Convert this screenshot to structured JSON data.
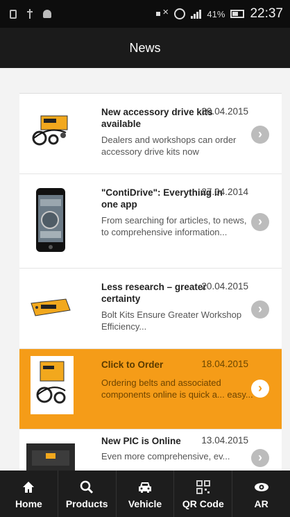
{
  "status_bar": {
    "battery_percent": "41%",
    "time": "22:37",
    "icons": [
      "screenshot-icon",
      "usb-icon",
      "android-icon",
      "mute-icon",
      "alarm-icon",
      "signal-icon",
      "battery-icon"
    ]
  },
  "header": {
    "title": "News"
  },
  "news": [
    {
      "title": "New accessory drive kits available",
      "date": "30.04.2015",
      "desc": "Dealers and workshops can order accessory drive kits now",
      "thumb": "belt-kit-image"
    },
    {
      "title": "\"ContiDrive\": Everything in one app",
      "date": "27.04.2014",
      "desc": "From searching for articles, to news, to comprehensive information...",
      "thumb": "phone-app-image"
    },
    {
      "title": "Less research – greater certainty",
      "date": "20.04.2015",
      "desc": "Bolt Kits Ensure Greater Workshop Efficiency...",
      "thumb": "bolt-kit-image"
    },
    {
      "title": "Click to Order",
      "date": "18.04.2015",
      "desc": "Ordering belts and associated components online is quick a... easy...",
      "thumb": "order-kit-image",
      "selected": true
    },
    {
      "title": "New PIC is Online",
      "date": "13.04.2015",
      "desc": "Even more comprehensive, ev...",
      "thumb": "pic-online-image"
    }
  ],
  "tabs": [
    {
      "label": "Home",
      "icon": "home-icon"
    },
    {
      "label": "Products",
      "icon": "search-icon"
    },
    {
      "label": "Vehicle",
      "icon": "car-icon"
    },
    {
      "label": "QR Code",
      "icon": "qr-code-icon"
    },
    {
      "label": "AR",
      "icon": "eye-icon"
    }
  ],
  "colors": {
    "accent": "#f59c18",
    "appbar": "#1b1b1b",
    "tabbar": "#1d1d1d"
  }
}
